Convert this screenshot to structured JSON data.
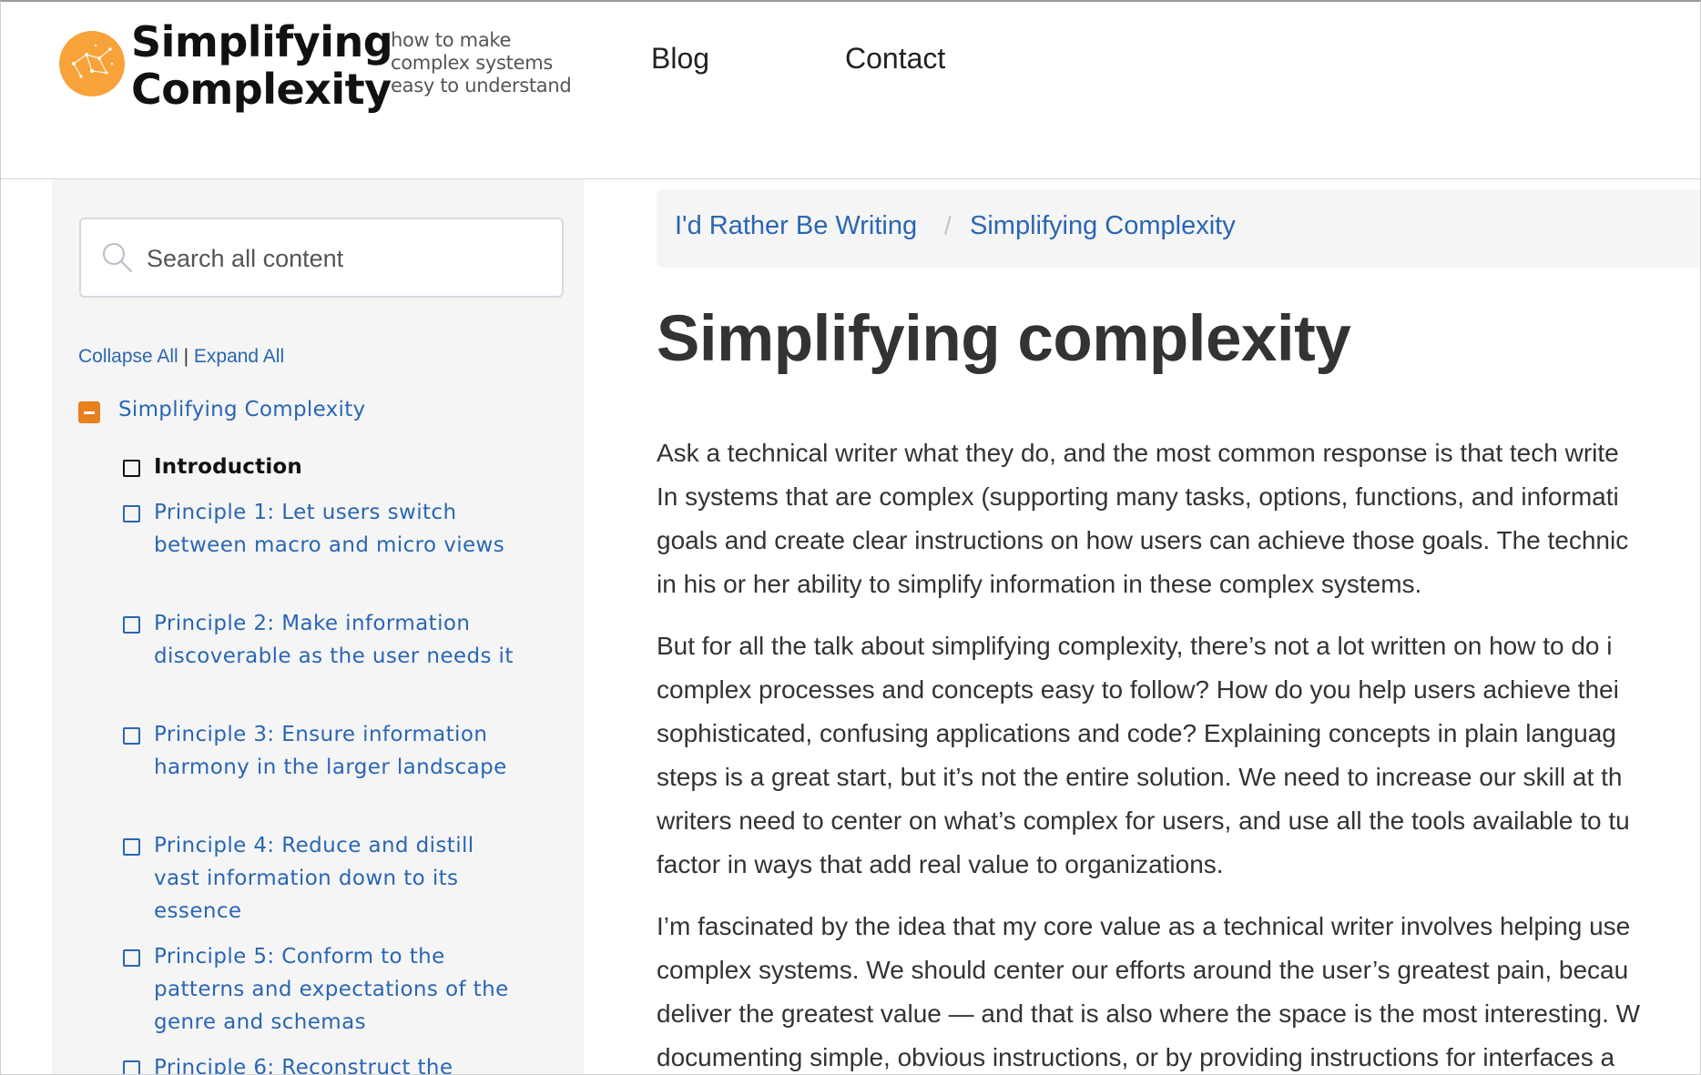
{
  "header": {
    "brand_line1": "Simplifying",
    "brand_line2": "Complexity",
    "tagline": [
      "how to make",
      "complex systems",
      "easy to understand"
    ],
    "nav": {
      "blog": "Blog",
      "contact": "Contact"
    },
    "logo_color": "#f8a23a"
  },
  "sidebar": {
    "search": {
      "placeholder": "Search all content"
    },
    "collapse_all": "Collapse All",
    "separator": "|",
    "expand_all": "Expand All",
    "toc_root": "Simplifying Complexity",
    "items": [
      {
        "label": "Introduction",
        "active": true
      },
      {
        "label": "Principle 1: Let users switch between macro and micro views"
      },
      {
        "label": "Principle 2: Make information discoverable as the user needs it"
      },
      {
        "label": "Principle 3: Ensure information harmony in the larger landscape"
      },
      {
        "label": "Principle 4: Reduce and distill vast information down to its essence"
      },
      {
        "label": "Principle 5: Conform to the patterns and expectations of the genre and schemas"
      },
      {
        "label": "Principle 6: Reconstruct the"
      }
    ]
  },
  "breadcrumb": {
    "items": [
      "I'd Rather Be Writing",
      "Simplifying Complexity"
    ],
    "separator": "/"
  },
  "main": {
    "title": "Simplifying complexity",
    "paragraphs": [
      [
        "Ask a technical writer what they do, and the most common response is that tech write",
        "In systems that are complex (supporting many tasks, options, functions, and informati",
        "goals and create clear instructions on how users can achieve those goals. The technic",
        "in his or her ability to simplify information in these complex systems."
      ],
      [
        "But for all the talk about simplifying complexity, there’s not a lot written on how to do i",
        "complex processes and concepts easy to follow? How do you help users achieve thei",
        "sophisticated, confusing applications and code? Explaining concepts in plain languag",
        "steps is a great start, but it’s not the entire solution. We need to increase our skill at th",
        "writers need to center on what’s complex for users, and use all the tools available to tu",
        "factor in ways that add real value to organizations."
      ],
      [
        "I’m fascinated by the idea that my core value as a technical writer involves helping use",
        "complex systems. We should center our efforts around the user’s greatest pain, becau",
        "deliver the greatest value — and that is also where the space is the most interesting. W",
        "documenting simple, obvious instructions, or by providing instructions for interfaces a"
      ]
    ]
  },
  "colors": {
    "link": "#2a66b3",
    "accent_orange": "#e8801e",
    "sidebar_bg": "#f5f5f5",
    "text": "#333333"
  }
}
